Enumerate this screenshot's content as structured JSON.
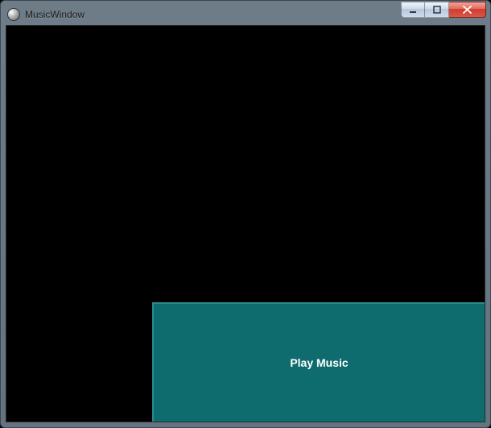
{
  "window": {
    "title": "MusicWindow"
  },
  "buttons": {
    "play_label": "Play Music"
  }
}
